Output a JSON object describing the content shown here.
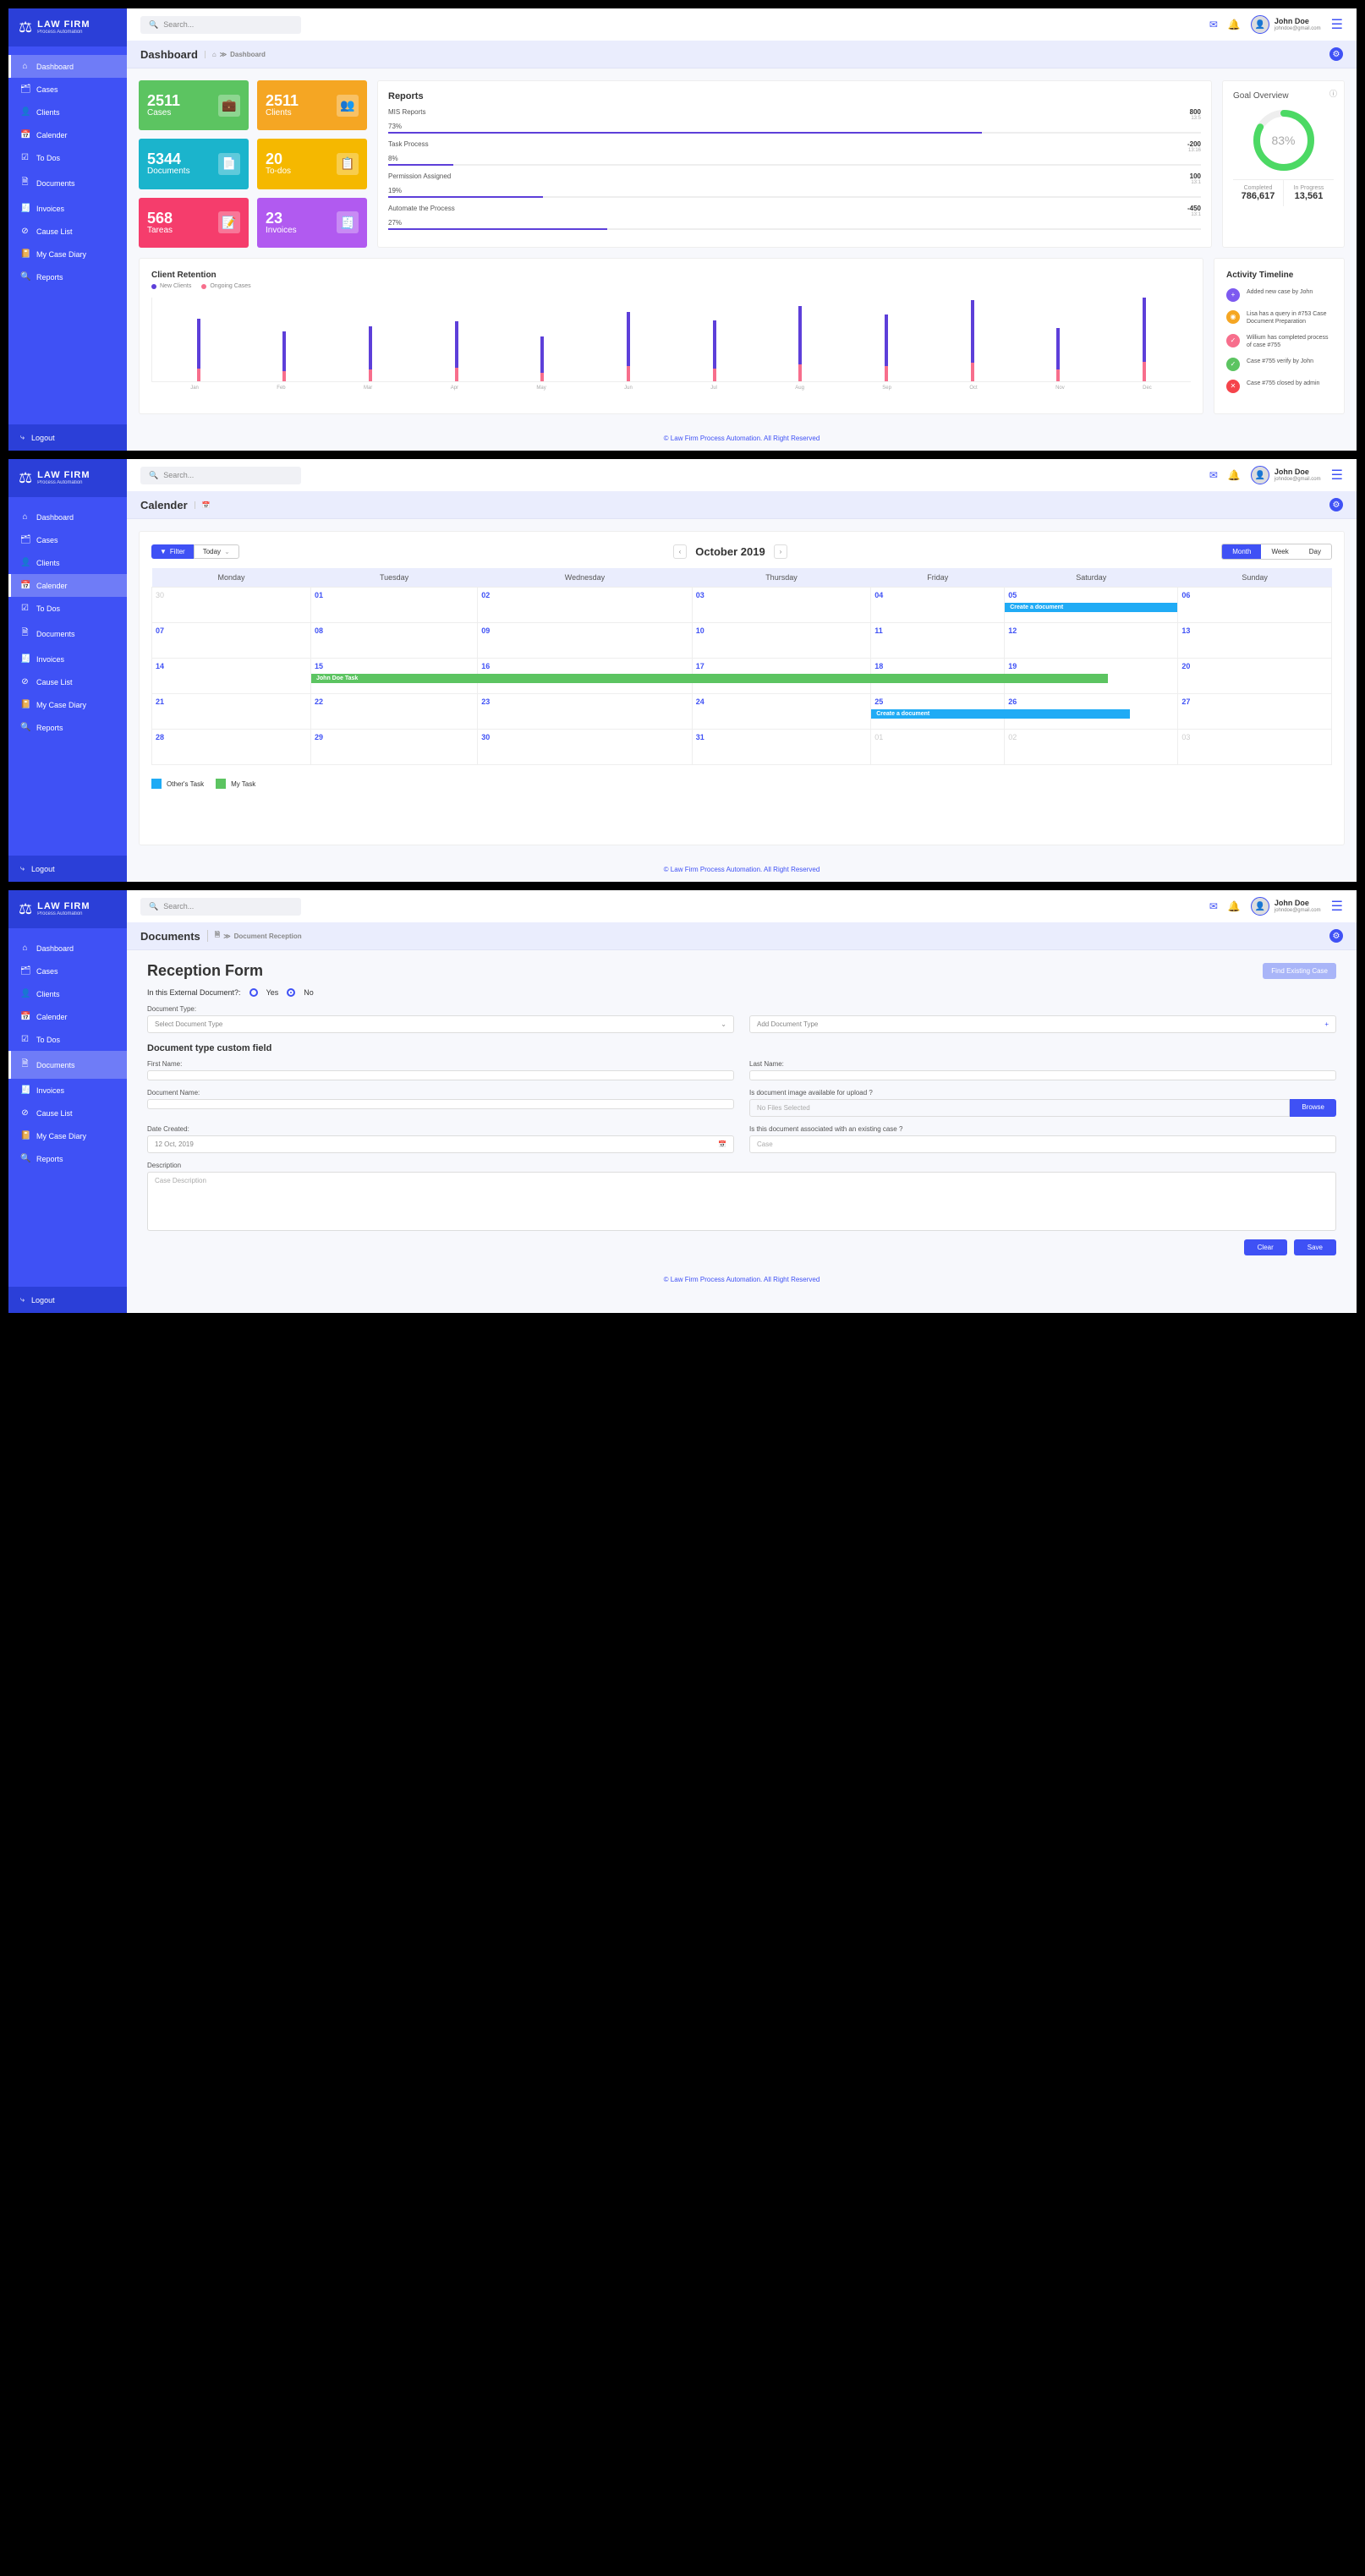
{
  "brand": {
    "title": "LAW FIRM",
    "subtitle": "Process Automation"
  },
  "search_placeholder": "Search...",
  "user": {
    "name": "John Doe",
    "email": "johndoe@gmail.com"
  },
  "nav": [
    "Dashboard",
    "Cases",
    "Clients",
    "Calender",
    "To Dos",
    "Documents",
    "Invoices",
    "Cause List",
    "My Case Diary",
    "Reports"
  ],
  "logout": "Logout",
  "footer": "© Law Firm Process Automation. All Right Reserved",
  "dashboard": {
    "title": "Dashboard",
    "crumb": "Dashboard",
    "stats": [
      {
        "val": "2511",
        "lbl": "Cases",
        "cls": "c-green",
        "icon": "💼"
      },
      {
        "val": "2511",
        "lbl": "Clients",
        "cls": "c-orange",
        "icon": "👥"
      },
      {
        "val": "5344",
        "lbl": "Documents",
        "cls": "c-teal",
        "icon": "📄"
      },
      {
        "val": "20",
        "lbl": "To-dos",
        "cls": "c-yellow",
        "icon": "📋"
      },
      {
        "val": "568",
        "lbl": "Tareas",
        "cls": "c-pink",
        "icon": "📝"
      },
      {
        "val": "23",
        "lbl": "Invoices",
        "cls": "c-purple",
        "icon": "🧾"
      }
    ],
    "reports": {
      "title": "Reports",
      "items": [
        {
          "name": "MIS Reports",
          "val": "800",
          "sub": "13:5",
          "pct": "73%",
          "w": 73
        },
        {
          "name": "Task Process",
          "val": "-200",
          "sub": "13:16",
          "pct": "8%",
          "w": 8
        },
        {
          "name": "Permission Assigned",
          "val": "100",
          "sub": "13:1",
          "pct": "19%",
          "w": 19
        },
        {
          "name": "Automate the Process",
          "val": "-450",
          "sub": "13:1",
          "pct": "27%",
          "w": 27
        }
      ]
    },
    "goal": {
      "title": "Goal Overview",
      "pct": "83%",
      "completed_lbl": "Completed",
      "completed": "786,617",
      "progress_lbl": "In Progress",
      "progress": "13,561"
    },
    "retention": {
      "title": "Client Retention",
      "legend1": "New Clients",
      "legend2": "Ongoing Cases"
    },
    "timeline": {
      "title": "Activity Timeline",
      "items": [
        {
          "text": "Added new case by John",
          "color": "#7d5af0",
          "icon": "+"
        },
        {
          "text": "Lisa has a query in #753 Case Document Preparation",
          "color": "#f5a623",
          "icon": "◉"
        },
        {
          "text": "Willium has completed process of case #755",
          "color": "#f76e8c",
          "icon": "✓"
        },
        {
          "text": "Case #755 verify by John",
          "color": "#5cc461",
          "icon": "✓"
        },
        {
          "text": "Case #755 closed by admin",
          "color": "#f5444b",
          "icon": "✕"
        }
      ]
    }
  },
  "calendar": {
    "title": "Calender",
    "filter": "Filter",
    "today": "Today",
    "month": "October 2019",
    "views": [
      "Month",
      "Week",
      "Day"
    ],
    "days": [
      "Monday",
      "Tuesday",
      "Wednesday",
      "Thursday",
      "Friday",
      "Saturday",
      "Sunday"
    ],
    "event1": "Create a document",
    "event2": "John Doe Task",
    "event3": "Create a document",
    "legend": {
      "other": "Other's Task",
      "my": "My Task"
    }
  },
  "documents": {
    "title": "Documents",
    "crumb": "Document Reception",
    "heading": "Reception Form",
    "find": "Find Existing Case",
    "external_q": "In this External Document?:",
    "yes": "Yes",
    "no": "No",
    "doctype_lbl": "Document  Type:",
    "doctype_ph": "Select Document Type",
    "add_ph": "Add  Document Type",
    "custom_title": "Document type custom field",
    "fname": "First Name:",
    "lname": "Last Name:",
    "docname": "Document Name:",
    "img_q": "Is document image available for upload ?",
    "nofiles": "No Files Selected",
    "browse": "Browse",
    "date_lbl": "Date Created:",
    "date_val": "12 Oct, 2019",
    "assoc_q": "Is this document associated with an existing case ?",
    "case_ph": "Case",
    "desc_lbl": "Description",
    "desc_ph": "Case Description",
    "clear": "Clear",
    "save": "Save"
  },
  "chart_data": {
    "type": "bar",
    "title": "Client Retention",
    "categories": [
      "Jan",
      "Feb",
      "Mar",
      "Apr",
      "May",
      "Jun",
      "Jul",
      "Aug",
      "Sep",
      "Oct",
      "Nov",
      "Dec"
    ],
    "series": [
      {
        "name": "New Clients",
        "values": [
          60,
          48,
          52,
          56,
          44,
          65,
          58,
          70,
          62,
          75,
          50,
          78
        ]
      },
      {
        "name": "Ongoing Cases",
        "values": [
          15,
          12,
          14,
          16,
          10,
          18,
          15,
          20,
          18,
          22,
          14,
          24
        ]
      }
    ],
    "ylim": [
      0,
      100
    ]
  }
}
